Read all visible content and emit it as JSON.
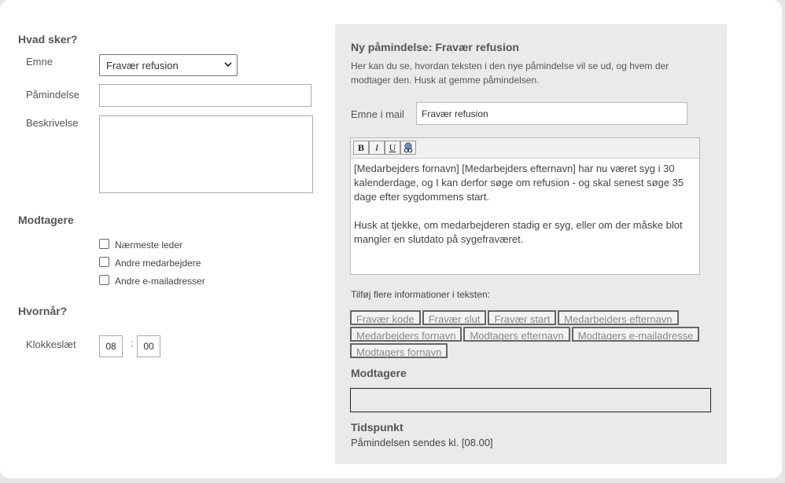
{
  "left": {
    "section_what": "Hvad sker?",
    "subject_label": "Emne",
    "subject_value": "Fravær refusion",
    "reminder_label": "Påmindelse",
    "reminder_value": "",
    "description_label": "Beskrivelse",
    "description_value": "",
    "section_recipients": "Modtagere",
    "recipients": [
      {
        "label": "Nærmeste leder",
        "checked": false
      },
      {
        "label": "Andre medarbejdere",
        "checked": false
      },
      {
        "label": "Andre e-mailadresser",
        "checked": false
      }
    ],
    "section_when": "Hvornår?",
    "time_label": "Klokkeslæt",
    "hour": "08",
    "separator": ":",
    "minute": "00"
  },
  "preview": {
    "title": "Ny påmindelse: Fravær refusion",
    "description": "Her kan du se, hvordan teksten i den nye påmindelse vil se ud, og hvem der modtager den. Husk at gemme påmindelsen.",
    "mail_subject_label": "Emne i mail",
    "mail_subject_value": "Fravær refusion",
    "toolbar": {
      "bold": "B",
      "italic": "I",
      "underline": "U",
      "link_icon": "link-icon"
    },
    "body_paragraph_1": "[Medarbejders fornavn] [Medarbejders efternavn] har nu været syg i 30 kalenderdage, og I kan derfor søge om refusion - og skal senest søge 35 dage efter sygdommens start.",
    "body_paragraph_2": "Husk at tjekke, om medarbejderen stadig er syg, eller om der måske blot mangler en slutdato på sygefraværet.",
    "insert_label": "Tilføj flere informationer i teksten:",
    "tokens": [
      "Fravær kode",
      "Fravær slut",
      "Fravær start",
      "Medarbejders efternavn",
      "Medarbejders fornavn",
      "Modtagers efternavn",
      "Modtagers e-mailadresse",
      "Modtagers fornavn"
    ],
    "recipients_heading": "Modtagere",
    "recipients_value": "",
    "time_heading": "Tidspunkt",
    "send_text": "Påmindelsen sendes kl. [08.00]"
  }
}
